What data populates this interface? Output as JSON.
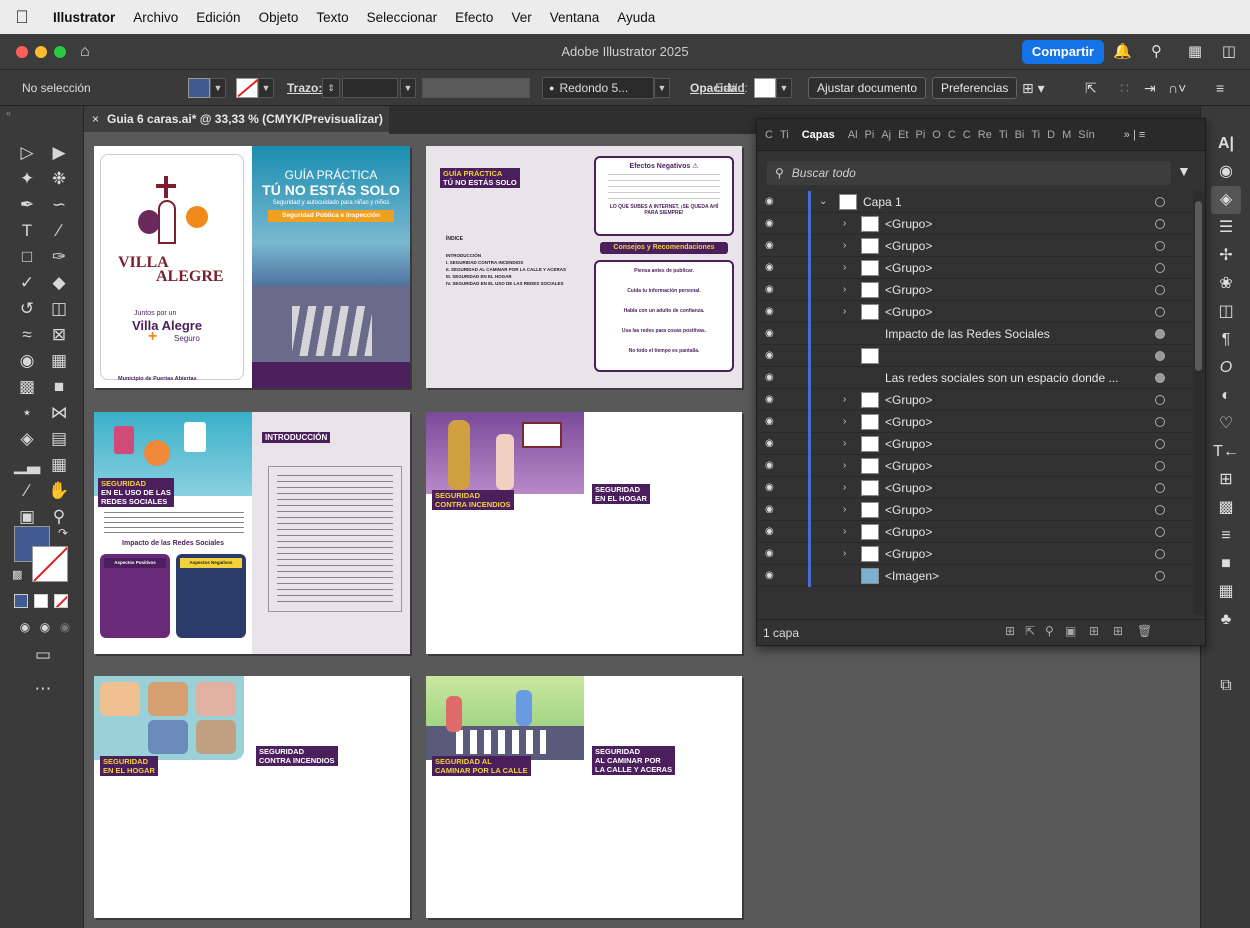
{
  "menubar": {
    "items": [
      "Illustrator",
      "Archivo",
      "Edición",
      "Objeto",
      "Texto",
      "Seleccionar",
      "Efecto",
      "Ver",
      "Ventana",
      "Ayuda"
    ]
  },
  "window": {
    "title": "Adobe Illustrator 2025",
    "share_label": "Compartir"
  },
  "control_bar": {
    "selection": "No selección",
    "stroke_label": "Trazo:",
    "brush_value": "Redondo 5...",
    "opacity_label": "Opacidad",
    "style_label": "Estilo:",
    "adjust_doc": "Ajustar documento",
    "preferences": "Preferencias"
  },
  "document": {
    "tab_title": "Guia 6 caras.ai* @ 33,33 % (CMYK/Previsualizar)"
  },
  "artboards": {
    "cover_title_1": "GUÍA PRÁCTICA",
    "cover_title_2": "TÚ NO ESTÁS SOLO",
    "cover_subtitle": "Seguridad y autocuidado para niñas y niños",
    "cover_badge": "Seguridad Pública e Inspección",
    "logo_1": "VILLA",
    "logo_2": "ALEGRE",
    "logo_3": "Juntos por un",
    "logo_4": "Villa Alegre",
    "logo_5": "Seguro",
    "municipio_prefix": "Municipio de ",
    "municipio_name": "Puertas Abiertas",
    "p2_header_1": "GUÍA PRÁCTICA",
    "p2_header_2": "TÚ NO ESTÁS SOLO",
    "index_title": "ÍNDICE",
    "index_items": [
      "INTRODUCCIÓN",
      "I. SEGURIDAD CONTRA INCENDIOS",
      "II. SEGURIDAD AL CAMINAR POR LA CALLE Y ACERAS",
      "III. SEGURIDAD EN EL HOGAR",
      "IV. SEGURIDAD EN EL USO DE LAS REDES SOCIALES"
    ],
    "neg_title": "Efectos Negativos ⚠",
    "consejos_title": "Consejos y Recomendaciones",
    "consejo_1": "Piensa antes de publicar.",
    "consejo_2": "Cuida tu información personal.",
    "consejo_3": "Habla con un adulto de confianza.",
    "consejo_4": "Usa las redes para cosas positivas.",
    "consejo_5": "No todo el tiempo es pantalla.",
    "neg_quote": "LO QUE SUBES A INTERNET, ¡SE QUEDA AHÍ PARA SIEMPRE!",
    "redes_label_1": "SEGURIDAD",
    "redes_label_2": "EN EL USO DE LAS",
    "redes_label_3": "REDES SOCIALES",
    "impacto_title": "Impacto de las Redes Sociales",
    "aspectos_pos": "Aspectos Positivos",
    "aspectos_neg": "Aspectos Negativos",
    "intro_title": "INTRODUCCIÓN",
    "incendios_a_1": "SEGURIDAD",
    "incendios_a_2": "CONTRA INCENDIOS",
    "hogar_a_1": "SEGURIDAD",
    "hogar_a_2": "EN EL HOGAR",
    "hogar_b_1": "SEGURIDAD",
    "hogar_b_2": "EN EL HOGAR",
    "incendios_b_1": "SEGURIDAD",
    "incendios_b_2": "CONTRA INCENDIOS",
    "calle_a_1": "SEGURIDAD AL",
    "calle_a_2": "CAMINAR POR LA CALLE",
    "calle_b_1": "SEGURIDAD",
    "calle_b_2": "AL CAMINAR POR",
    "calle_b_3": "LA CALLE Y ACERAS"
  },
  "layers_panel": {
    "tabs": [
      "C",
      "Ti",
      "Capas",
      "Al",
      "Pi",
      "Aj",
      "Et",
      "Pi",
      "O",
      "C",
      "C",
      "Re",
      "Ti",
      "Bi",
      "Ti",
      "D",
      "M",
      "Sín"
    ],
    "search_placeholder": "Buscar todo",
    "layer_name": "Capa 1",
    "rows": [
      "<Grupo>",
      "<Grupo>",
      "<Grupo>",
      "<Grupo>",
      "<Grupo>",
      "Impacto de las Redes Sociales",
      "",
      "Las redes sociales son un espacio donde ...",
      "<Grupo>",
      "<Grupo>",
      "<Grupo>",
      "<Grupo>",
      "<Grupo>",
      "<Grupo>",
      "<Grupo>",
      "<Grupo>",
      "<Imagen>"
    ],
    "footer_count": "1 capa"
  }
}
